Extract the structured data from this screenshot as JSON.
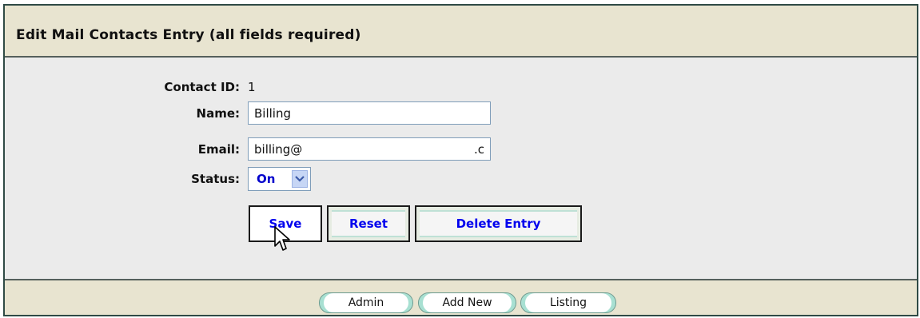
{
  "header": {
    "title": "Edit Mail Contacts Entry (all fields required)"
  },
  "form": {
    "contact_id_label": "Contact ID:",
    "contact_id_value": "1",
    "name_label": "Name:",
    "name_value": "Billing",
    "email_label": "Email:",
    "email_value": "billing@",
    "email_tail": ".c",
    "status_label": "Status:",
    "status_value": "On"
  },
  "buttons": {
    "save": "Save",
    "reset": "Reset",
    "delete": "Delete Entry"
  },
  "footer": {
    "admin": "Admin",
    "add_new": "Add New",
    "listing": "Listing"
  },
  "colors": {
    "header_bg": "#e8e4d0",
    "form_bg": "#ebebeb",
    "button_text": "#0000ee",
    "select_value": "#0000cc"
  }
}
